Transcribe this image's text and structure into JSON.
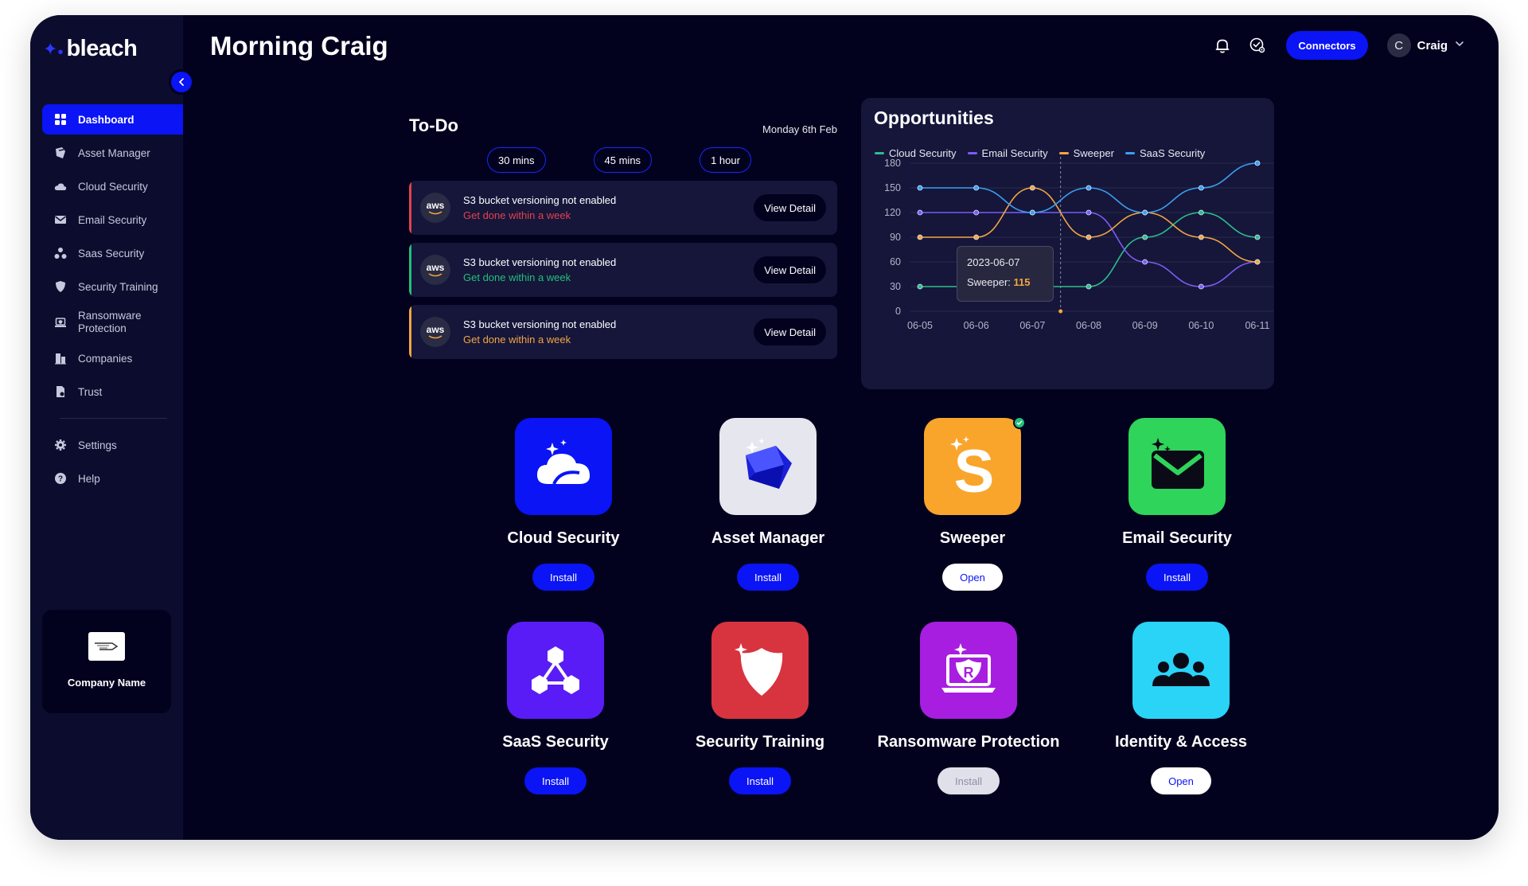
{
  "brand": {
    "name": "bleach"
  },
  "header": {
    "greeting": "Morning Craig",
    "connectors_label": "Connectors",
    "user_initial": "C",
    "user_name": "Craig"
  },
  "sidebar": {
    "items": [
      {
        "label": "Dashboard",
        "icon": "grid-icon",
        "active": true
      },
      {
        "label": "Asset Manager",
        "icon": "asset-icon"
      },
      {
        "label": "Cloud Security",
        "icon": "cloud-icon"
      },
      {
        "label": "Email Security",
        "icon": "mail-icon"
      },
      {
        "label": "Saas Security",
        "icon": "network-icon"
      },
      {
        "label": "Security Training",
        "icon": "shield-icon"
      },
      {
        "label": "Ransomware Protection",
        "icon": "laptop-icon"
      },
      {
        "label": "Companies",
        "icon": "building-icon"
      },
      {
        "label": "Trust",
        "icon": "document-icon"
      }
    ],
    "bottom_items": [
      {
        "label": "Settings",
        "icon": "gear-icon"
      },
      {
        "label": "Help",
        "icon": "help-icon"
      }
    ],
    "company_name": "Company Name"
  },
  "todo": {
    "title": "To-Do",
    "date": "Monday 6th Feb",
    "chips": [
      "30 mins",
      "45 mins",
      "1 hour"
    ],
    "tasks": [
      {
        "provider": "aws",
        "title": "S3 bucket versioning not enabled",
        "subtitle": "Get done within a week",
        "action": "View Detail",
        "color": "#e5414d"
      },
      {
        "provider": "aws",
        "title": "S3 bucket versioning not enabled",
        "subtitle": "Get done within a week",
        "action": "View Detail",
        "color": "#22c07a"
      },
      {
        "provider": "aws",
        "title": "S3 bucket versioning not enabled",
        "subtitle": "Get done within a week",
        "action": "View Detail",
        "color": "#f4a640"
      }
    ]
  },
  "opportunities": {
    "title": "Opportunities",
    "tooltip": {
      "date": "2023-06-07",
      "series": "Sweeper:",
      "value": "115"
    }
  },
  "chart_data": {
    "type": "line",
    "x": [
      "06-05",
      "06-06",
      "06-07",
      "06-08",
      "06-09",
      "06-10",
      "06-11"
    ],
    "ylim": [
      0,
      180
    ],
    "yticks": [
      0,
      30,
      60,
      90,
      120,
      150,
      180
    ],
    "grid": true,
    "legend": "top-left",
    "series": [
      {
        "name": "Cloud Security",
        "color": "#2dbe8a",
        "values": [
          30,
          30,
          30,
          30,
          90,
          120,
          90
        ]
      },
      {
        "name": "Email Security",
        "color": "#7b5cf5",
        "values": [
          120,
          120,
          120,
          120,
          60,
          30,
          60
        ]
      },
      {
        "name": "Sweeper",
        "color": "#f4a640",
        "values": [
          90,
          90,
          150,
          90,
          120,
          90,
          60
        ]
      },
      {
        "name": "SaaS Security",
        "color": "#3aa0ef",
        "values": [
          150,
          150,
          120,
          150,
          120,
          150,
          180
        ]
      }
    ]
  },
  "apps": [
    {
      "name": "Cloud Security",
      "action": "Install",
      "state": "install",
      "color": "#0a14f5",
      "icon": "cloud-icon"
    },
    {
      "name": "Asset Manager",
      "action": "Install",
      "state": "install",
      "color": "#e6e6ee",
      "icon": "cube-icon"
    },
    {
      "name": "Sweeper",
      "action": "Open",
      "state": "open",
      "color": "#f9a52c",
      "icon": "sweeper-s-icon",
      "installed": true
    },
    {
      "name": "Email Security",
      "action": "Install",
      "state": "install",
      "color": "#2fd45a",
      "icon": "envelope-icon"
    },
    {
      "name": "SaaS Security",
      "action": "Install",
      "state": "install",
      "color": "#5a1cf6",
      "icon": "hexagon-network-icon"
    },
    {
      "name": "Security Training",
      "action": "Install",
      "state": "install",
      "color": "#d8343f",
      "icon": "shield-icon"
    },
    {
      "name": "Ransomware Protection",
      "action": "Install",
      "state": "disabled",
      "color": "#a81ee0",
      "icon": "laptop-shield-icon"
    },
    {
      "name": "Identity & Access",
      "action": "Open",
      "state": "open",
      "color": "#29d4f7",
      "icon": "people-icon"
    }
  ]
}
